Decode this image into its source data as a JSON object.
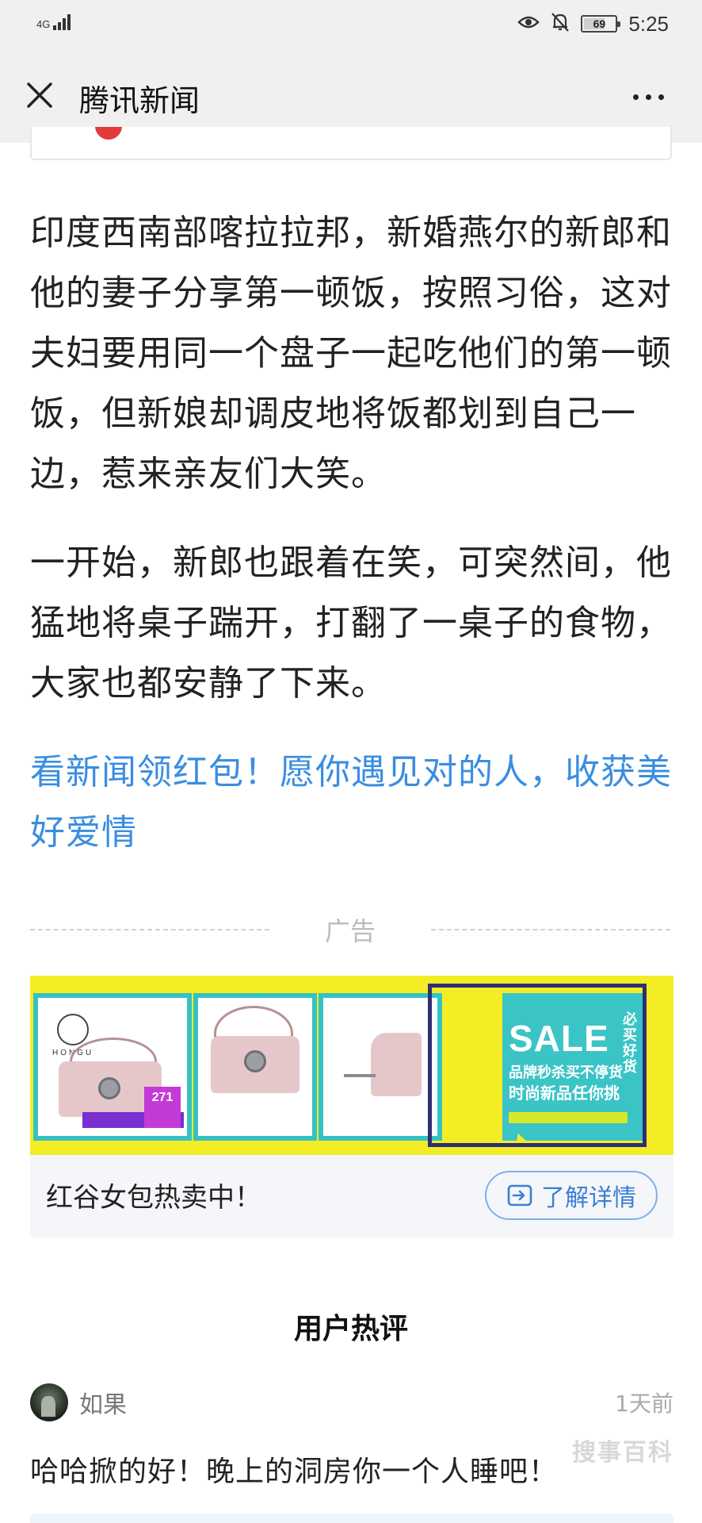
{
  "status_bar": {
    "network": "4G",
    "battery": "69",
    "battery_level_percent": 69,
    "time": "5:25"
  },
  "title_bar": {
    "title": "腾讯新闻"
  },
  "article": {
    "paragraphs": [
      "印度西南部喀拉拉邦，新婚燕尔的新郎和他的妻子分享第一顿饭，按照习俗，这对夫妇要用同一个盘子一起吃他们的第一顿饭，但新娘却调皮地将饭都划到自己一边，惹来亲友们大笑。",
      "一开始，新郎也跟着在笑，可突然间，他猛地将桌子踹开，打翻了一桌子的食物，大家也都安静了下来。"
    ],
    "promo_link": "看新闻领红包！愿你遇见对的人，收获美好爱情"
  },
  "ad": {
    "label": "广告",
    "brand": "HONGU",
    "sale_text": "SALE",
    "side_text": "必买好货",
    "sub1": "品牌秒杀买不停货",
    "sub2": "时尚新品任你挑",
    "price": "271",
    "caption": "红谷女包热卖中！",
    "button_label": "了解详情"
  },
  "comments": {
    "title": "用户热评",
    "items": [
      {
        "user": "如果",
        "time": "1天前",
        "text": "哈哈掀的好！晚上的洞房你一个人睡吧！"
      }
    ]
  },
  "colors": {
    "link_blue": "#3a8ee0",
    "ad_yellow": "#f4ec24",
    "ad_teal": "#35c2c4",
    "bar_bg": "#f0f0f0"
  }
}
